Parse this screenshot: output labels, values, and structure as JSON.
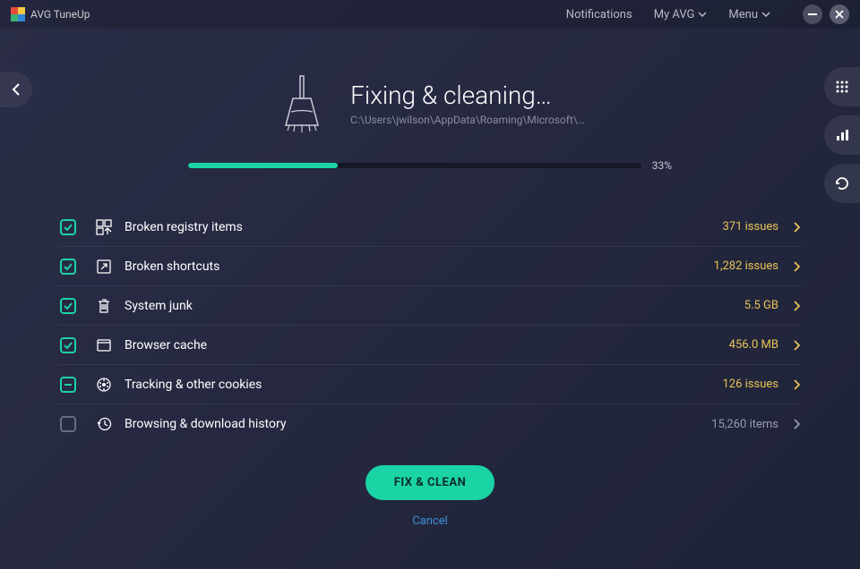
{
  "titlebar": {
    "app_name": "AVG TuneUp",
    "notifications_label": "Notifications",
    "my_avg_label": "My AVG",
    "menu_label": "Menu"
  },
  "hero": {
    "title": "Fixing & cleaning…",
    "path": "C:\\Users\\jwilson\\AppData\\Roaming\\Microsoft\\…"
  },
  "progress": {
    "percent": 33,
    "text": "33%"
  },
  "items": [
    {
      "label": "Broken registry items",
      "value": "371 issues",
      "checked": "checked",
      "muted": false,
      "icon": "registry"
    },
    {
      "label": "Broken shortcuts",
      "value": "1,282 issues",
      "checked": "checked",
      "muted": false,
      "icon": "shortcut"
    },
    {
      "label": "System junk",
      "value": "5.5 GB",
      "checked": "checked",
      "muted": false,
      "icon": "trash"
    },
    {
      "label": "Browser cache",
      "value": "456.0 MB",
      "checked": "checked",
      "muted": false,
      "icon": "browser"
    },
    {
      "label": "Tracking & other cookies",
      "value": "126 issues",
      "checked": "indeterminate",
      "muted": false,
      "icon": "cookie"
    },
    {
      "label": "Browsing & download history",
      "value": "15,260 items",
      "checked": "unchecked",
      "muted": true,
      "icon": "history"
    }
  ],
  "actions": {
    "primary": "FIX & CLEAN",
    "cancel": "Cancel"
  },
  "colors": {
    "accent": "#1bd4a6",
    "warn": "#e8c455",
    "link": "#3d8fd6"
  }
}
